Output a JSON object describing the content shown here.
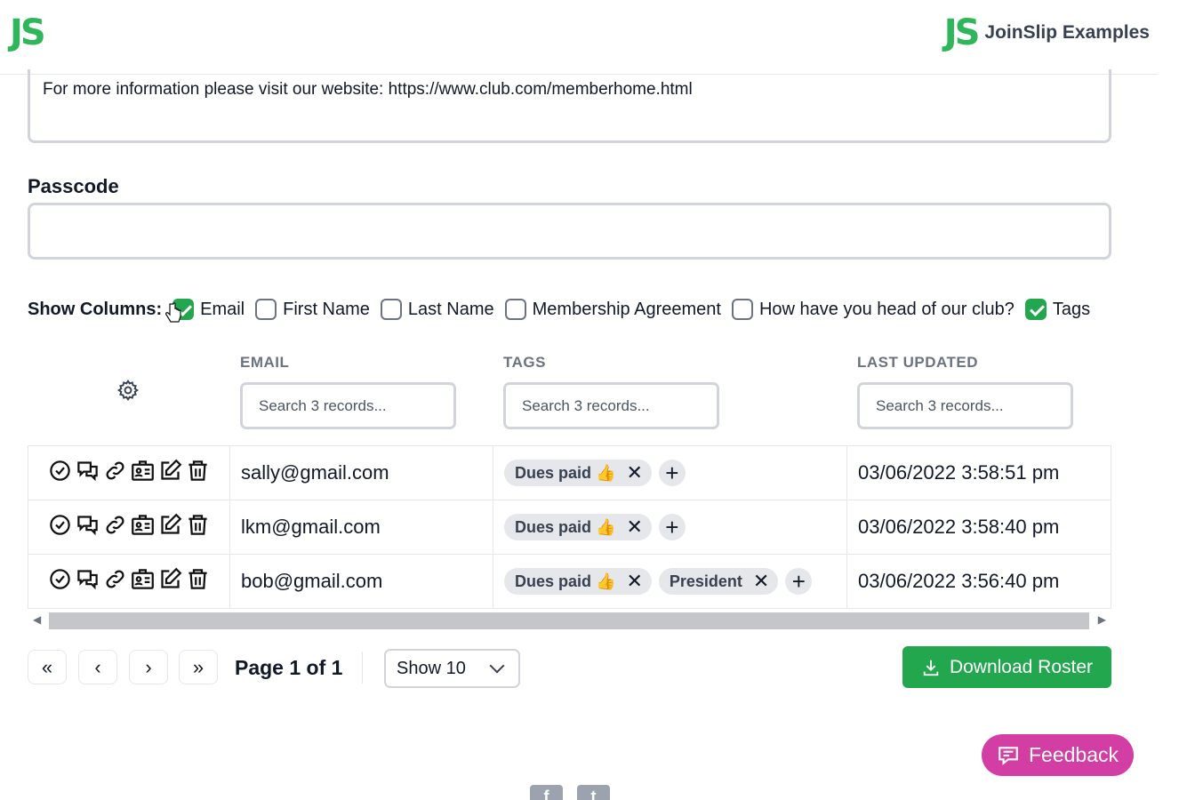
{
  "header": {
    "logo": "JS",
    "brand_logo": "JS",
    "brand_name": "JoinSlip Examples"
  },
  "form": {
    "info_text": "For more information please visit our website: https://www.club.com/memberhome.html",
    "passcode_label": "Passcode",
    "passcode_value": ""
  },
  "show_columns": {
    "label": "Show Columns:",
    "options": [
      {
        "label": "Email",
        "checked": true
      },
      {
        "label": "First Name",
        "checked": false
      },
      {
        "label": "Last Name",
        "checked": false
      },
      {
        "label": "Membership Agreement",
        "checked": false
      },
      {
        "label": "How have you head of our club?",
        "checked": false
      },
      {
        "label": "Tags",
        "checked": true
      }
    ]
  },
  "table": {
    "columns": [
      "EMAIL",
      "TAGS",
      "LAST UPDATED"
    ],
    "search_placeholder": "Search 3 records...",
    "rows": [
      {
        "email": "sally@gmail.com",
        "tags": [
          "Dues paid 👍"
        ],
        "updated": "03/06/2022 3:58:51 pm"
      },
      {
        "email": "lkm@gmail.com",
        "tags": [
          "Dues paid 👍"
        ],
        "updated": "03/06/2022 3:58:40 pm"
      },
      {
        "email": "bob@gmail.com",
        "tags": [
          "Dues paid 👍",
          "President"
        ],
        "updated": "03/06/2022 3:56:40 pm"
      }
    ]
  },
  "pagination": {
    "first": "«",
    "prev": "‹",
    "next": "›",
    "last": "»",
    "page_text": "Page 1 of 1",
    "show_value": "Show 10"
  },
  "buttons": {
    "download": "Download Roster",
    "feedback": "Feedback"
  },
  "colors": {
    "brand_green": "#2fb65a",
    "button_green": "#22a74f",
    "feedback_pink": "#d33ea4"
  }
}
